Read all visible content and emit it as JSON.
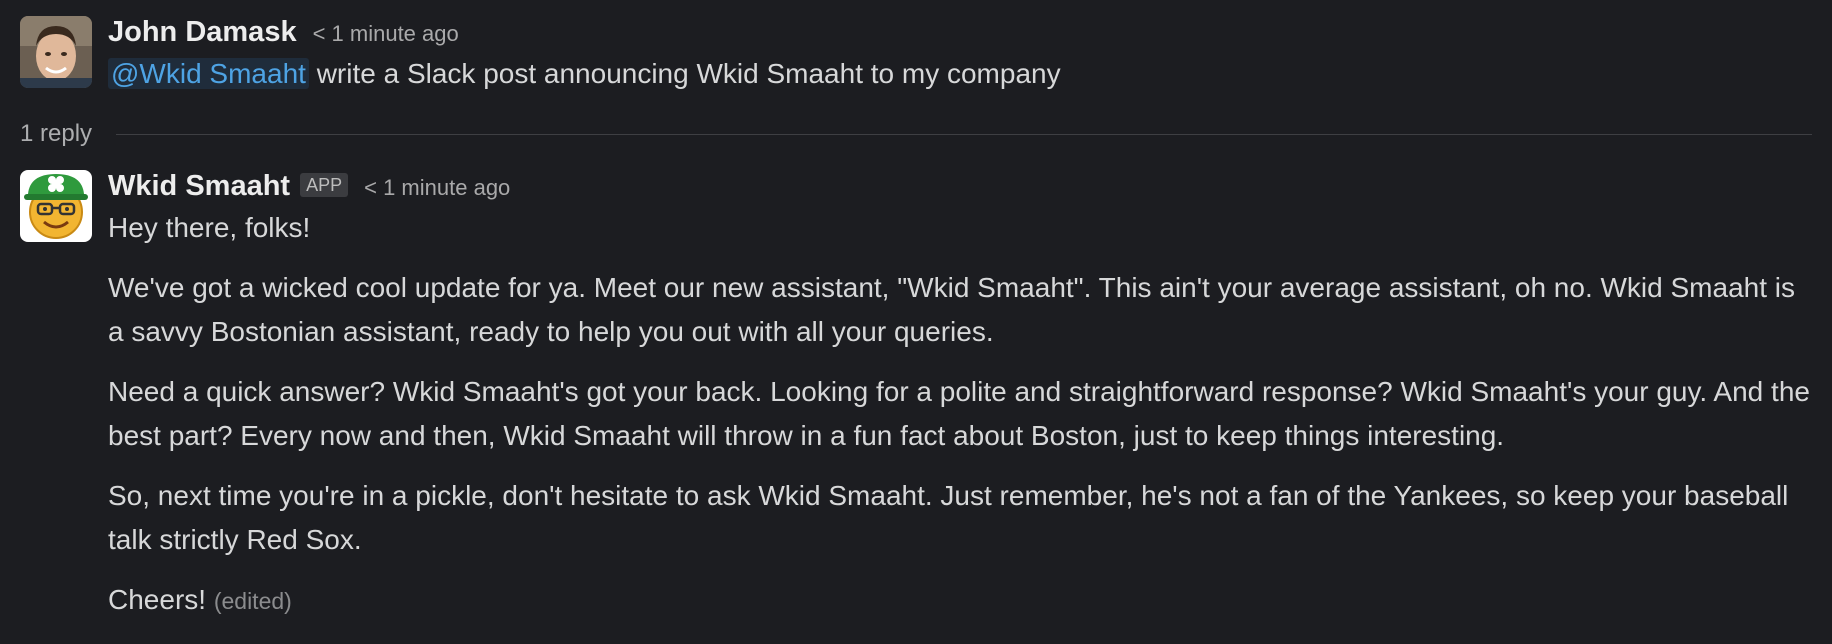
{
  "user_message": {
    "author": "John Damask",
    "timestamp": "< 1 minute ago",
    "mention": "@Wkid Smaaht",
    "text": " write a Slack post announcing Wkid Smaaht to my company"
  },
  "thread": {
    "reply_count": "1 reply"
  },
  "bot_message": {
    "author": "Wkid Smaaht",
    "badge": "APP",
    "timestamp": "< 1 minute ago",
    "paragraphs": [
      "Hey there, folks!",
      "We've got a wicked cool update for ya. Meet our new assistant, \"Wkid Smaaht\". This ain't your average assistant, oh no. Wkid Smaaht is a savvy Bostonian assistant, ready to help you out with all your queries.",
      "Need a quick answer? Wkid Smaaht's got your back. Looking for a polite and straightforward response? Wkid Smaaht's your guy. And the best part? Every now and then, Wkid Smaaht will throw in a fun fact about Boston, just to keep things interesting.",
      "So, next time you're in a pickle, don't hesitate to ask Wkid Smaaht. Just remember, he's not a fan of the Yankees, so keep your baseball talk strictly Red Sox."
    ],
    "closing": "Cheers!",
    "edited_label": "(edited)"
  }
}
